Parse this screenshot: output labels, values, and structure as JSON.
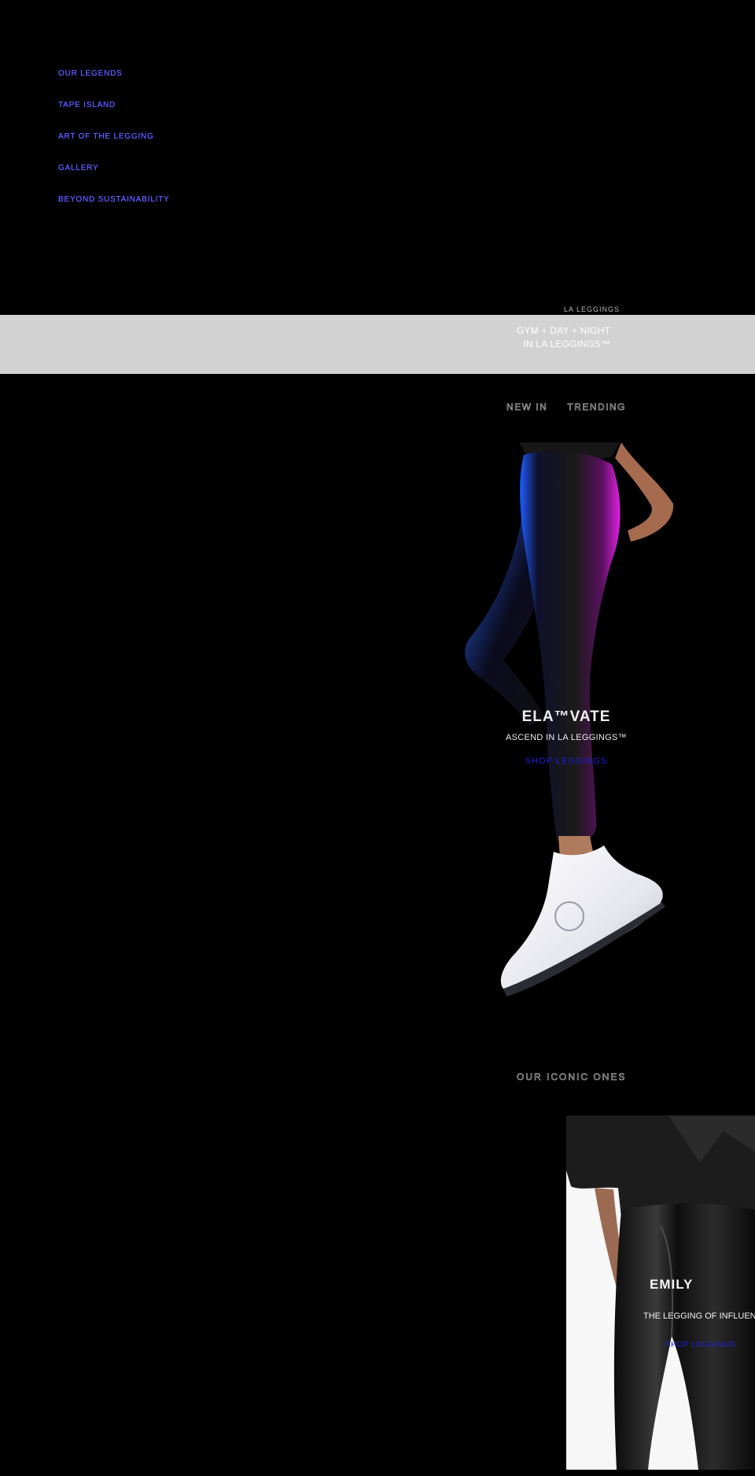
{
  "menu": {
    "items": [
      {
        "label": "Our Legends"
      },
      {
        "label": "Tape Island"
      },
      {
        "label": "Art of the Legging"
      },
      {
        "label": "Gallery"
      },
      {
        "label": "Beyond Sustainability"
      }
    ]
  },
  "banner": {
    "kicker": "LA LEGGINGS",
    "line1": "GYM + DAY + NIGHT",
    "line2": "IN LA LEGGINGS™"
  },
  "tabs": [
    {
      "label": "New In"
    },
    {
      "label": "Trending"
    }
  ],
  "hero": {
    "title": "ELA™VATE",
    "subtitle": "ASCEND IN LA LEGGINGS™",
    "cta": "SHOP LEGGINGS"
  },
  "legends_section": {
    "title": "OUR ICONIC ONES"
  },
  "card": {
    "title": "EMILY",
    "subtitle": "THE LEGGING OF INFLUENCERS",
    "cta": "SHOP LEGGINGS"
  },
  "colors": {
    "background": "#000000",
    "band": "#d2d2d2",
    "link": "#1f1fd6",
    "menu_link": "#6c6cf0",
    "glow_blue": "#1e5cff",
    "glow_magenta": "#e020e0"
  }
}
